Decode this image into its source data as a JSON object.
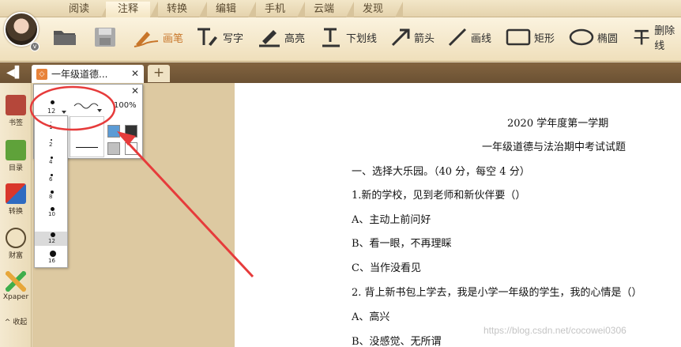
{
  "ribbon": {
    "tabs": [
      "阅读",
      "注释",
      "转换",
      "编辑",
      "手机",
      "云端",
      "发现"
    ],
    "active_tab": "注释"
  },
  "toolbar": {
    "tools": [
      {
        "label": "",
        "icon": "open-folder-icon"
      },
      {
        "label": "",
        "icon": "save-icon"
      },
      {
        "label": "画笔",
        "icon": "brush-pen-icon",
        "active": true
      },
      {
        "label": "写字",
        "icon": "text-pen-icon"
      },
      {
        "label": "高亮",
        "icon": "highlight-icon"
      },
      {
        "label": "下划线",
        "icon": "underline-icon"
      },
      {
        "label": "箭头",
        "icon": "arrow-icon"
      },
      {
        "label": "画线",
        "icon": "line-icon"
      },
      {
        "label": "矩形",
        "icon": "rectangle-icon"
      },
      {
        "label": "椭圆",
        "icon": "ellipse-icon"
      },
      {
        "label": "删除线",
        "icon": "strikethrough-icon"
      }
    ]
  },
  "doc_tabs": {
    "current_title": "一年级道德...",
    "new_tab": "+"
  },
  "sidebar": {
    "items": [
      {
        "label": "书签",
        "icon": "bookmark-icon"
      },
      {
        "label": "目录",
        "icon": "toc-icon"
      },
      {
        "label": "转换",
        "icon": "convert-icon"
      },
      {
        "label": "财富",
        "icon": "coins-icon"
      },
      {
        "label": "Xpaper",
        "icon": "xpaper-icon"
      },
      {
        "label": "^ 收起",
        "icon": "collapse-icon"
      }
    ]
  },
  "pen_popup": {
    "size_value": "12",
    "opacity": "100%",
    "size_options": [
      "1",
      "2",
      "4",
      "6",
      "8",
      "10",
      "12",
      "16"
    ],
    "selected_size": "12",
    "colors": [
      "#5b9bd5",
      "#333333",
      "#c0c0c0",
      "#ffffff"
    ]
  },
  "document": {
    "lines": [
      "2020 学年度第一学期",
      "一年级道德与法治期中考试试题",
      "一、选择大乐园。（40 分，每空 4 分）",
      "1.新的学校，见到老师和新伙伴要（）",
      "A、主动上前问好",
      "B、看一眼，不再理睬",
      "C、当作没看见",
      "2. 背上新书包上学去，我是小学一年级的学生，我的心情是（）",
      "A、高兴",
      "B、没感觉、无所谓"
    ],
    "watermark": "https://blog.csdn.net/cocowei0306"
  },
  "annotation": {
    "color": "#e63b3b"
  }
}
